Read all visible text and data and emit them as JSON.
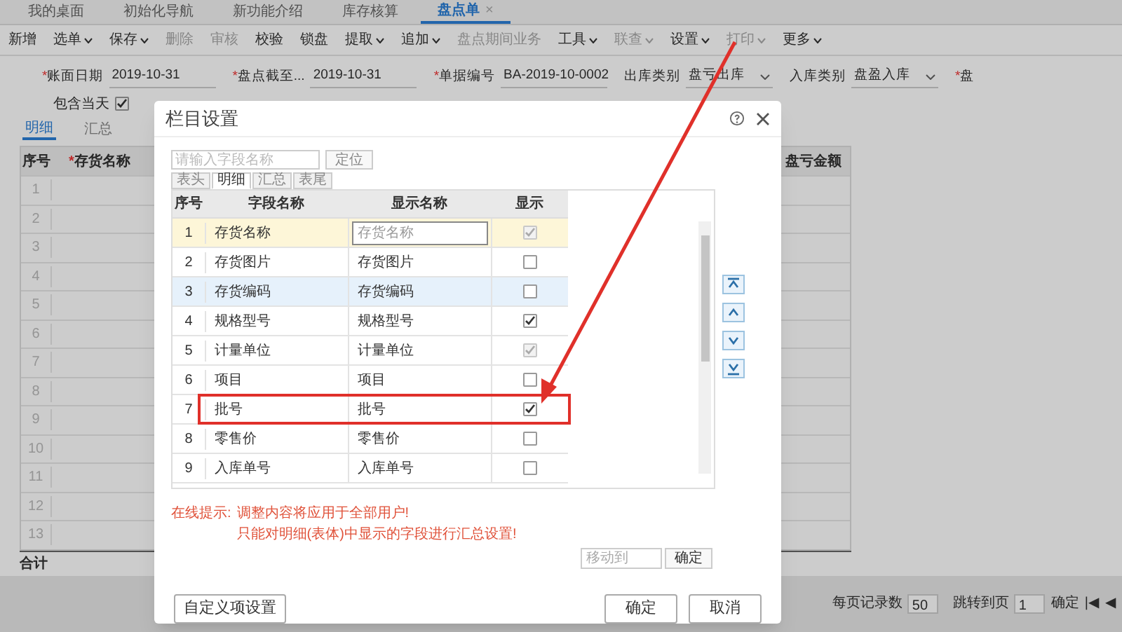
{
  "tabs": [
    {
      "label": "我的桌面",
      "selected": false,
      "closable": false
    },
    {
      "label": "初始化导航",
      "selected": false,
      "closable": false
    },
    {
      "label": "新功能介绍",
      "selected": false,
      "closable": false
    },
    {
      "label": "库存核算",
      "selected": false,
      "closable": false
    },
    {
      "label": "盘点单",
      "selected": true,
      "closable": true,
      "close": "×"
    }
  ],
  "toolbar": [
    {
      "label": "新增",
      "dropdown": false,
      "disabled": false
    },
    {
      "label": "选单",
      "dropdown": true,
      "disabled": false
    },
    {
      "label": "保存",
      "dropdown": true,
      "disabled": false
    },
    {
      "label": "删除",
      "dropdown": false,
      "disabled": true
    },
    {
      "label": "审核",
      "dropdown": false,
      "disabled": true
    },
    {
      "label": "校验",
      "dropdown": false,
      "disabled": false
    },
    {
      "label": "锁盘",
      "dropdown": false,
      "disabled": false
    },
    {
      "label": "提取",
      "dropdown": true,
      "disabled": false
    },
    {
      "label": "追加",
      "dropdown": true,
      "disabled": false
    },
    {
      "label": "盘点期间业务",
      "dropdown": false,
      "disabled": true
    },
    {
      "label": "工具",
      "dropdown": true,
      "disabled": false
    },
    {
      "label": "联查",
      "dropdown": true,
      "disabled": true
    },
    {
      "label": "设置",
      "dropdown": true,
      "disabled": false
    },
    {
      "label": "打印",
      "dropdown": true,
      "disabled": true
    },
    {
      "label": "更多",
      "dropdown": true,
      "disabled": false
    }
  ],
  "form": [
    {
      "kind": "text",
      "label": "账面日期",
      "required_mark": "*",
      "value": "2019-10-31"
    },
    {
      "kind": "text",
      "label": "盘点截至...",
      "required_mark": "*",
      "value": "2019-10-31"
    },
    {
      "kind": "text",
      "label": "单据编号",
      "required_mark": "*",
      "value": "BA-2019-10-0002"
    },
    {
      "kind": "select",
      "label": "出库类别",
      "value": "盘亏出库"
    },
    {
      "kind": "select",
      "label": "入库类别",
      "value": "盘盈入库"
    },
    {
      "kind": "text",
      "label": "盘",
      "required_mark": "*"
    }
  ],
  "include_today": {
    "label": "包含当天",
    "checked": true
  },
  "detail_tabs": [
    {
      "label": "明细",
      "selected": true
    },
    {
      "label": "汇总",
      "selected": false
    }
  ],
  "table": {
    "columns": [
      {
        "label": "序号"
      },
      {
        "label": "存货名称",
        "required_mark": "*"
      },
      {
        "label": "盘亏金额"
      }
    ],
    "rows": [
      "1",
      "2",
      "3",
      "4",
      "5",
      "6",
      "7",
      "8",
      "9",
      "10",
      "11",
      "12",
      "13"
    ],
    "total_label": "合计"
  },
  "pager": {
    "page_size_label": "每页记录数",
    "page_size": "50",
    "jump_label": "跳转到页",
    "page": "1",
    "confirm": "确定",
    "first": "|◀",
    "prev": "◀"
  },
  "dialog": {
    "title": "栏目设置",
    "search": {
      "placeholder": "请输入字段名称"
    },
    "locate": "定位",
    "tabs": [
      {
        "label": "表头",
        "selected": false
      },
      {
        "label": "明细",
        "selected": true
      },
      {
        "label": "汇总",
        "selected": false
      },
      {
        "label": "表尾",
        "selected": false
      }
    ],
    "columns": [
      "序号",
      "字段名称",
      "显示名称",
      "显示"
    ],
    "rows": [
      {
        "no": "1",
        "field": "存货名称",
        "display": "存货名称",
        "checked": true,
        "disabled": true,
        "selected": true,
        "hover": false,
        "boxed": false
      },
      {
        "no": "2",
        "field": "存货图片",
        "display": "存货图片",
        "checked": false,
        "disabled": false,
        "selected": false,
        "hover": false,
        "boxed": false
      },
      {
        "no": "3",
        "field": "存货编码",
        "display": "存货编码",
        "checked": false,
        "disabled": false,
        "selected": false,
        "hover": true,
        "boxed": false
      },
      {
        "no": "4",
        "field": "规格型号",
        "display": "规格型号",
        "checked": true,
        "disabled": false,
        "selected": false,
        "hover": false,
        "boxed": false
      },
      {
        "no": "5",
        "field": "计量单位",
        "display": "计量单位",
        "checked": true,
        "disabled": true,
        "selected": false,
        "hover": false,
        "boxed": false
      },
      {
        "no": "6",
        "field": "项目",
        "display": "项目",
        "checked": false,
        "disabled": false,
        "selected": false,
        "hover": false,
        "boxed": false
      },
      {
        "no": "7",
        "field": "批号",
        "display": "批号",
        "checked": true,
        "disabled": false,
        "selected": false,
        "hover": false,
        "boxed": true
      },
      {
        "no": "8",
        "field": "零售价",
        "display": "零售价",
        "checked": false,
        "disabled": false,
        "selected": false,
        "hover": false,
        "boxed": false
      },
      {
        "no": "9",
        "field": "入库单号",
        "display": "入库单号",
        "checked": false,
        "disabled": false,
        "selected": false,
        "hover": false,
        "boxed": false
      }
    ],
    "move_buttons": [
      {
        "kind": "top"
      },
      {
        "kind": "up"
      },
      {
        "kind": "down"
      },
      {
        "kind": "bottom"
      }
    ],
    "hint_label": "在线提示:",
    "hints": [
      "调整内容将应用于全部用户!",
      "只能对明细(表体)中显示的字段进行汇总设置!"
    ],
    "move_to": {
      "placeholder": "移动到",
      "button": "确定"
    },
    "custom_button": "自定义项设置",
    "ok": "确定",
    "cancel": "取消"
  }
}
